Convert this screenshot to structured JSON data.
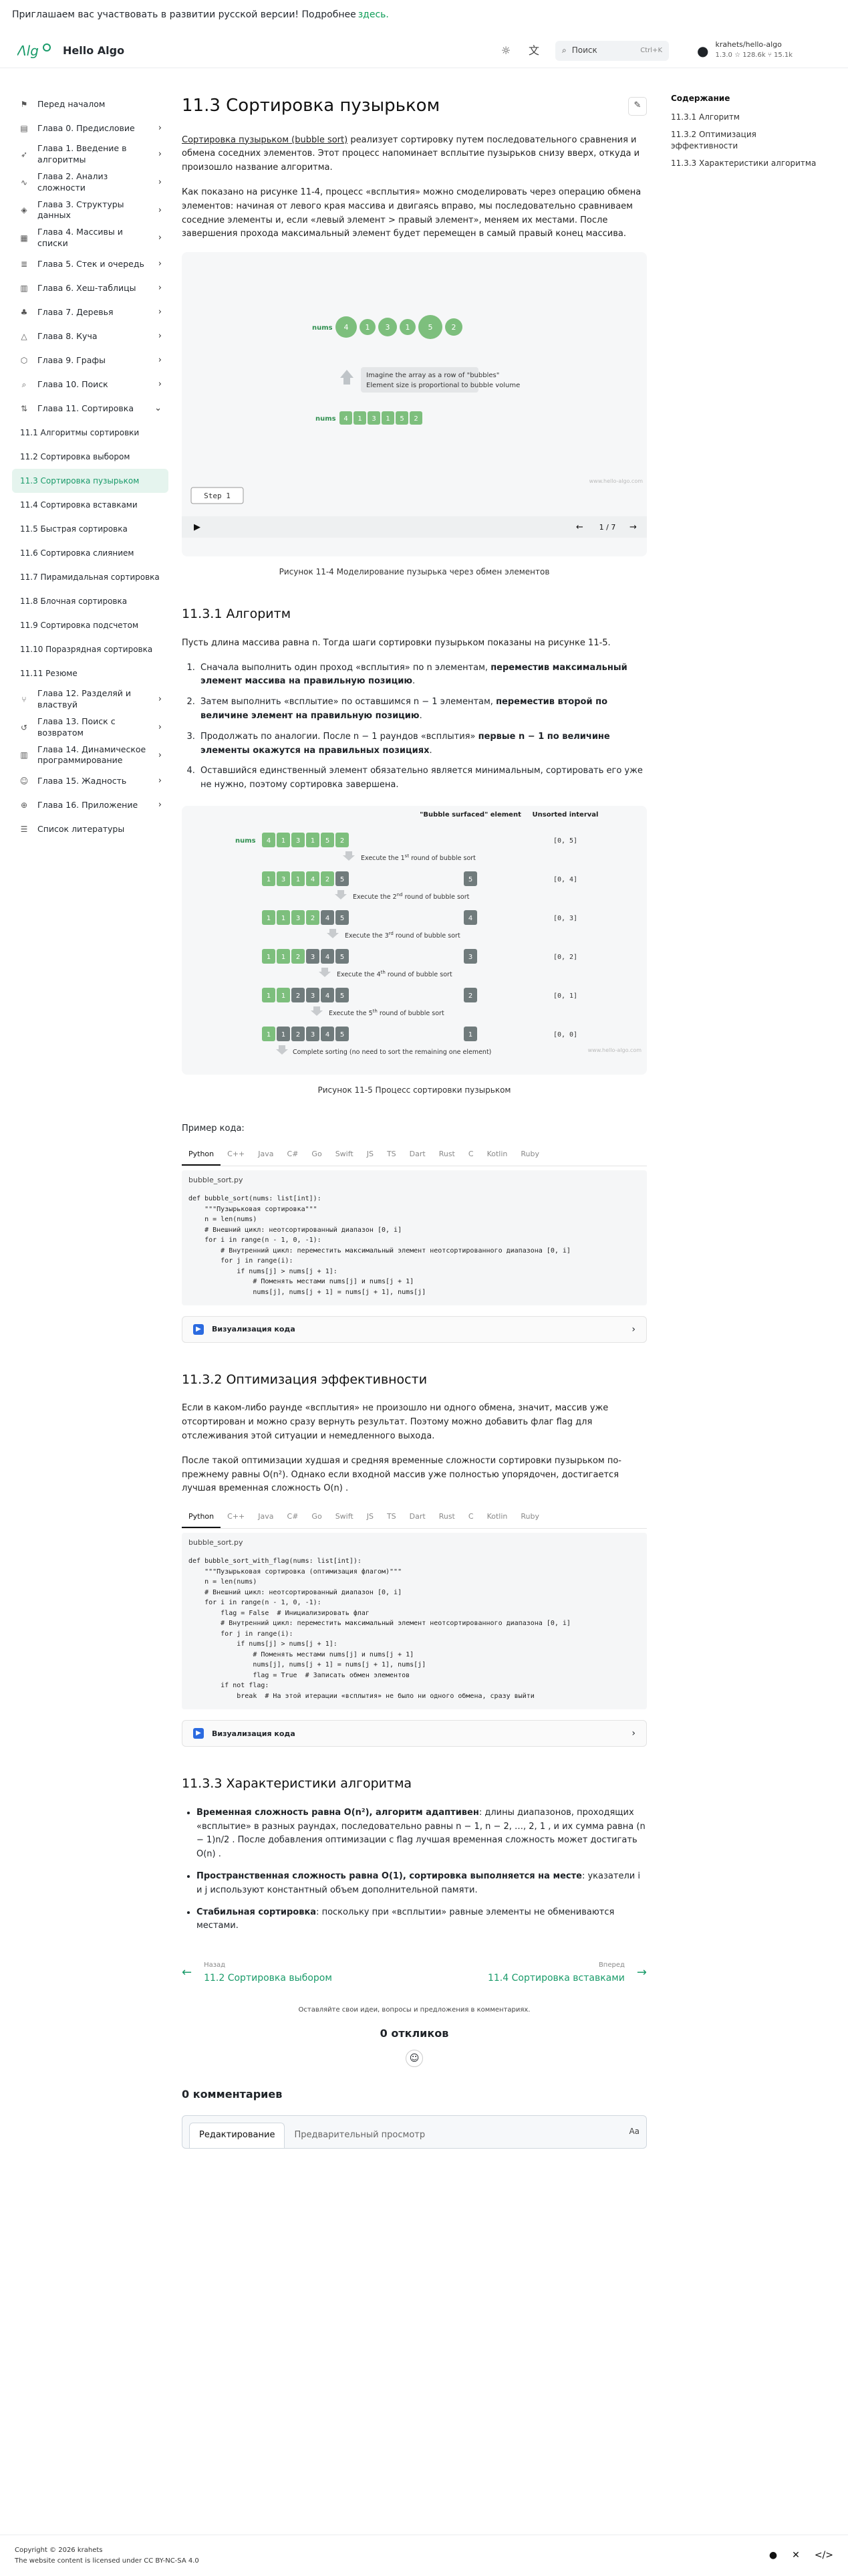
{
  "banner": {
    "text": "Приглашаем вас участвовать в развитии русской версии! Подробнее",
    "link": "здесь."
  },
  "header": {
    "brand": "Hello Algo",
    "search_placeholder": "Поиск",
    "search_kbd": "Ctrl+K",
    "repo_name": "krahets/hello-algo",
    "repo_stats": "1.3.0  ☆ 128.6k  ⑂ 15.1k"
  },
  "sidebar": {
    "items": [
      {
        "icon": "flag-icon",
        "label": "Перед началом",
        "chev": ""
      },
      {
        "icon": "book-icon",
        "label": "Глава 0. Предисловие",
        "chev": "›"
      },
      {
        "icon": "rocket-icon",
        "label": "Глава 1. Введение в алгоритмы",
        "chev": "›"
      },
      {
        "icon": "chart-icon",
        "label": "Глава 2. Анализ сложности",
        "chev": "›"
      },
      {
        "icon": "shapes-icon",
        "label": "Глава 3. Структуры данных",
        "chev": "›"
      },
      {
        "icon": "grid-icon",
        "label": "Глава 4. Массивы и списки",
        "chev": "›"
      },
      {
        "icon": "stack-icon",
        "label": "Глава 5. Стек и очередь",
        "chev": "›"
      },
      {
        "icon": "table-icon",
        "label": "Глава 6. Хеш-таблицы",
        "chev": "›"
      },
      {
        "icon": "tree-icon",
        "label": "Глава 7. Деревья",
        "chev": "›"
      },
      {
        "icon": "heap-icon",
        "label": "Глава 8. Куча",
        "chev": "›"
      },
      {
        "icon": "graph-icon",
        "label": "Глава 9. Графы",
        "chev": "›"
      },
      {
        "icon": "search-icon",
        "label": "Глава 10. Поиск",
        "chev": "›"
      },
      {
        "icon": "sort-icon",
        "label": "Глава 11. Сортировка",
        "chev": "⌄"
      }
    ],
    "sub": [
      {
        "label": "11.1 Алгоритмы сортировки",
        "active": false
      },
      {
        "label": "11.2 Сортировка выбором",
        "active": false
      },
      {
        "label": "11.3 Сортировка пузырьком",
        "active": true
      },
      {
        "label": "11.4 Сортировка вставками",
        "active": false
      },
      {
        "label": "11.5 Быстрая сортировка",
        "active": false
      },
      {
        "label": "11.6 Сортировка слиянием",
        "active": false
      },
      {
        "label": "11.7 Пирамидальная сортировка",
        "active": false
      },
      {
        "label": "11.8 Блочная сортировка",
        "active": false
      },
      {
        "label": "11.9 Сортировка подсчетом",
        "active": false
      },
      {
        "label": "11.10 Поразрядная сортировка",
        "active": false
      },
      {
        "label": "11.11 Резюме",
        "active": false
      }
    ],
    "items2": [
      {
        "icon": "split-icon",
        "label": "Глава 12. Разделяй и властвуй",
        "chev": "›"
      },
      {
        "icon": "backtrack-icon",
        "label": "Глава 13. Поиск с возвратом",
        "chev": "›"
      },
      {
        "icon": "table-icon",
        "label": "Глава 14. Динамическое программирование",
        "chev": "›"
      },
      {
        "icon": "greedy-icon",
        "label": "Глава 15. Жадность",
        "chev": "›"
      },
      {
        "icon": "appendix-icon",
        "label": "Глава 16. Приложение",
        "chev": "›"
      },
      {
        "icon": "list-icon",
        "label": "Список литературы",
        "chev": ""
      }
    ]
  },
  "main": {
    "title": "11.3   Сортировка пузырьком",
    "intro1_link": "Сортировка пузырьком (bubble sort)",
    "intro1": " реализует сортировку путем последовательного сравнения и обмена соседних элементов. Этот процесс напоминает всплытие пузырьков снизу вверх, откуда и произошло название алгоритма.",
    "intro2": "Как показано на рисунке 11-4, процесс «всплытия» можно смоделировать через операцию обмена элементов: начиная от левого края массива и двигаясь вправо, мы последовательно сравниваем соседние элементы и, если «левый элемент > правый элемент», меняем их местами. После завершения прохода максимальный элемент будет перемещен в самый правый конец массива.",
    "fig1": {
      "nums_label": "nums",
      "top_values": [
        "4",
        "1",
        "3",
        "1",
        "5",
        "2"
      ],
      "bottom_values": [
        "4",
        "1",
        "3",
        "1",
        "5",
        "2"
      ],
      "note1": "Imagine the array as a row of \"bubbles\"",
      "note2": "Element size is proportional to bubble volume",
      "step": "Step 1",
      "counter": "1 / 7",
      "watermark": "www.hello-algo.com"
    },
    "fig1_caption": "Рисунок 11-4   Моделирование пузырька через обмен элементов",
    "s1_title": "11.3.1   Алгоритм",
    "s1_intro": "Пусть длина массива равна n. Тогда шаги сортировки пузырьком показаны на рисунке 11-5.",
    "steps": [
      {
        "a": "Сначала выполнить один проход «всплытия» по n элементам, ",
        "b": "переместив максимальный элемент массива на правильную позицию",
        "c": "."
      },
      {
        "a": "Затем выполнить «всплытие» по оставшимся n − 1 элементам, ",
        "b": "переместив второй по величине элемент на правильную позицию",
        "c": "."
      },
      {
        "a": "Продолжать по аналогии. После n − 1 раундов «всплытия» ",
        "b": "первые n − 1 по величине элементы окажутся на правильных позициях",
        "c": "."
      },
      {
        "a": "Оставшийся единственный элемент обязательно является минимальным, сортировать его уже не нужно, поэтому сортировка завершена.",
        "b": "",
        "c": ""
      }
    ],
    "fig2": {
      "head_surfaced": "\"Bubble surfaced\" element",
      "head_interval": "Unsorted interval",
      "nums_label": "nums",
      "rows": [
        {
          "vals": [
            "4",
            "1",
            "3",
            "1",
            "5",
            "2"
          ],
          "sorted": 0,
          "surf": "",
          "interval": "[0, 5]"
        },
        {
          "vals": [
            "1",
            "3",
            "1",
            "4",
            "2",
            "5"
          ],
          "sorted": 1,
          "surf": "5",
          "interval": "[0, 4]"
        },
        {
          "vals": [
            "1",
            "1",
            "3",
            "2",
            "4",
            "5"
          ],
          "sorted": 2,
          "surf": "4",
          "interval": "[0, 3]"
        },
        {
          "vals": [
            "1",
            "1",
            "2",
            "3",
            "4",
            "5"
          ],
          "sorted": 3,
          "surf": "3",
          "interval": "[0, 2]"
        },
        {
          "vals": [
            "1",
            "1",
            "2",
            "3",
            "4",
            "5"
          ],
          "sorted": 4,
          "surf": "2",
          "interval": "[0, 1]"
        },
        {
          "vals": [
            "1",
            "1",
            "2",
            "3",
            "4",
            "5"
          ],
          "sorted": 5,
          "surf": "1",
          "interval": "[0, 0]"
        }
      ],
      "round_base": "Execute the ",
      "round_tail": " round of bubble sort",
      "rounds": [
        "1",
        "2",
        "3",
        "4",
        "5"
      ],
      "sups": [
        "st",
        "nd",
        "rd",
        "th",
        "th"
      ],
      "complete": "Complete sorting (no need to sort the remaining one element)",
      "watermark": "www.hello-algo.com"
    },
    "fig2_caption": "Рисунок 11-5   Процесс сортировки пузырьком",
    "code_label": "Пример кода:",
    "lang_tabs": [
      "Python",
      "C++",
      "Java",
      "C#",
      "Go",
      "Swift",
      "JS",
      "TS",
      "Dart",
      "Rust",
      "C",
      "Kotlin",
      "Ruby"
    ],
    "code1_file": "bubble_sort.py",
    "code1": "def bubble_sort(nums: list[int]):\n    \"\"\"Пузырьковая сортировка\"\"\"\n    n = len(nums)\n    # Внешний цикл: неотсортированный диапазон [0, i]\n    for i in range(n - 1, 0, -1):\n        # Внутренний цикл: переместить максимальный элемент неотсортированного диапазона [0, i]\n        for j in range(i):\n            if nums[j] > nums[j + 1]:\n                # Поменять местами nums[j] и nums[j + 1]\n                nums[j], nums[j + 1] = nums[j + 1], nums[j]",
    "visual_label": "Визуализация кода",
    "s2_title": "11.3.2   Оптимизация эффективности",
    "s2_p1": "Если в каком-либо раунде «всплытия» не произошло ни одного обмена, значит, массив уже отсортирован и можно сразу вернуть результат. Поэтому можно добавить флаг flag для отслеживания этой ситуации и немедленного выхода.",
    "s2_p2": "После такой оптимизации худшая и средняя временные сложности сортировки пузырьком по-прежнему равны O(n²). Однако если входной массив уже полностью упорядочен, достигается лучшая временная сложность O(n) .",
    "code2_file": "bubble_sort.py",
    "code2": "def bubble_sort_with_flag(nums: list[int]):\n    \"\"\"Пузырьковая сортировка (оптимизация флагом)\"\"\"\n    n = len(nums)\n    # Внешний цикл: неотсортированный диапазон [0, i]\n    for i in range(n - 1, 0, -1):\n        flag = False  # Инициализировать флаг\n        # Внутренний цикл: переместить максимальный элемент неотсортированного диапазона [0, i]\n        for j in range(i):\n            if nums[j] > nums[j + 1]:\n                # Поменять местами nums[j] и nums[j + 1]\n                nums[j], nums[j + 1] = nums[j + 1], nums[j]\n                flag = True  # Записать обмен элементов\n        if not flag:\n            break  # На этой итерации «всплытия» не было ни одного обмена, сразу выйти",
    "s3_title": "11.3.3   Характеристики алгоритма",
    "chars": [
      {
        "b": "Временная сложность равна O(n²), алгоритм адаптивен",
        "t": ": длины диапазонов, проходящих «всплытие» в разных раундах, последовательно равны n − 1, n − 2, …, 2, 1 , и их сумма равна (n − 1)n/2 . После добавления оптимизации с flag лучшая временная сложность может достигать O(n) ."
      },
      {
        "b": "Пространственная сложность равна O(1), сортировка выполняется на месте",
        "t": ": указатели i и j используют константный объем дополнительной памяти."
      },
      {
        "b": "Стабильная сортировка",
        "t": ": поскольку при «всплытии» равные элементы не обмениваются местами."
      }
    ],
    "prev_meta": "Назад",
    "prev_title": "11.2 Сортировка выбором",
    "next_meta": "Вперед",
    "next_title": "11.4 Сортировка вставками",
    "comments_note": "Оставляйте свои идеи, вопросы и предложения в комментариях.",
    "reactions": "0 откликов",
    "comments_title": "0 комментариев",
    "editor_tab1": "Редактирование",
    "editor_tab2": "Предварительный просмотр",
    "editor_aa": "Aa"
  },
  "toc": {
    "title": "Содержание",
    "items": [
      "11.3.1   Алгоритм",
      "11.3.2   Оптимизация эффективности",
      "11.3.3   Характеристики алгоритма"
    ]
  },
  "footer": {
    "copy": "Copyright © 2026 krahets",
    "license": "The website content is licensed under CC BY-NC-SA 4.0"
  },
  "colors": {
    "accent": "#1a9b6a",
    "bubble": "#7dbf7d",
    "bubble_sorted": "#707b7c"
  }
}
